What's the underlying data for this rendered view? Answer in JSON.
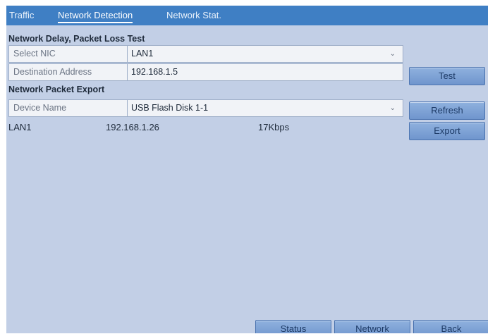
{
  "tabs": [
    {
      "label": "Traffic",
      "active": false
    },
    {
      "label": "Network Detection",
      "active": true
    },
    {
      "label": "Network Stat.",
      "active": false
    }
  ],
  "delay_test": {
    "title": "Network Delay, Packet Loss Test",
    "select_nic_label": "Select NIC",
    "select_nic_value": "LAN1",
    "destination_label": "Destination Address",
    "destination_value": "192.168.1.5",
    "test_button": "Test"
  },
  "packet_export": {
    "title": "Network Packet Export",
    "device_label": "Device Name",
    "device_value": "USB Flash Disk 1-1",
    "refresh_button": "Refresh",
    "export_button": "Export",
    "interface": "LAN1",
    "ip": "192.168.1.26",
    "rate": "17Kbps"
  },
  "footer": {
    "status_button": "Status",
    "network_button": "Network",
    "back_button": "Back"
  },
  "icons": {
    "dropdown": "chevron-down-icon"
  },
  "colors": {
    "tab_bar": "#3f7fc4",
    "panel": "#c2cfe6",
    "button": "#7ea3d6",
    "field": "#f1f3f7"
  }
}
